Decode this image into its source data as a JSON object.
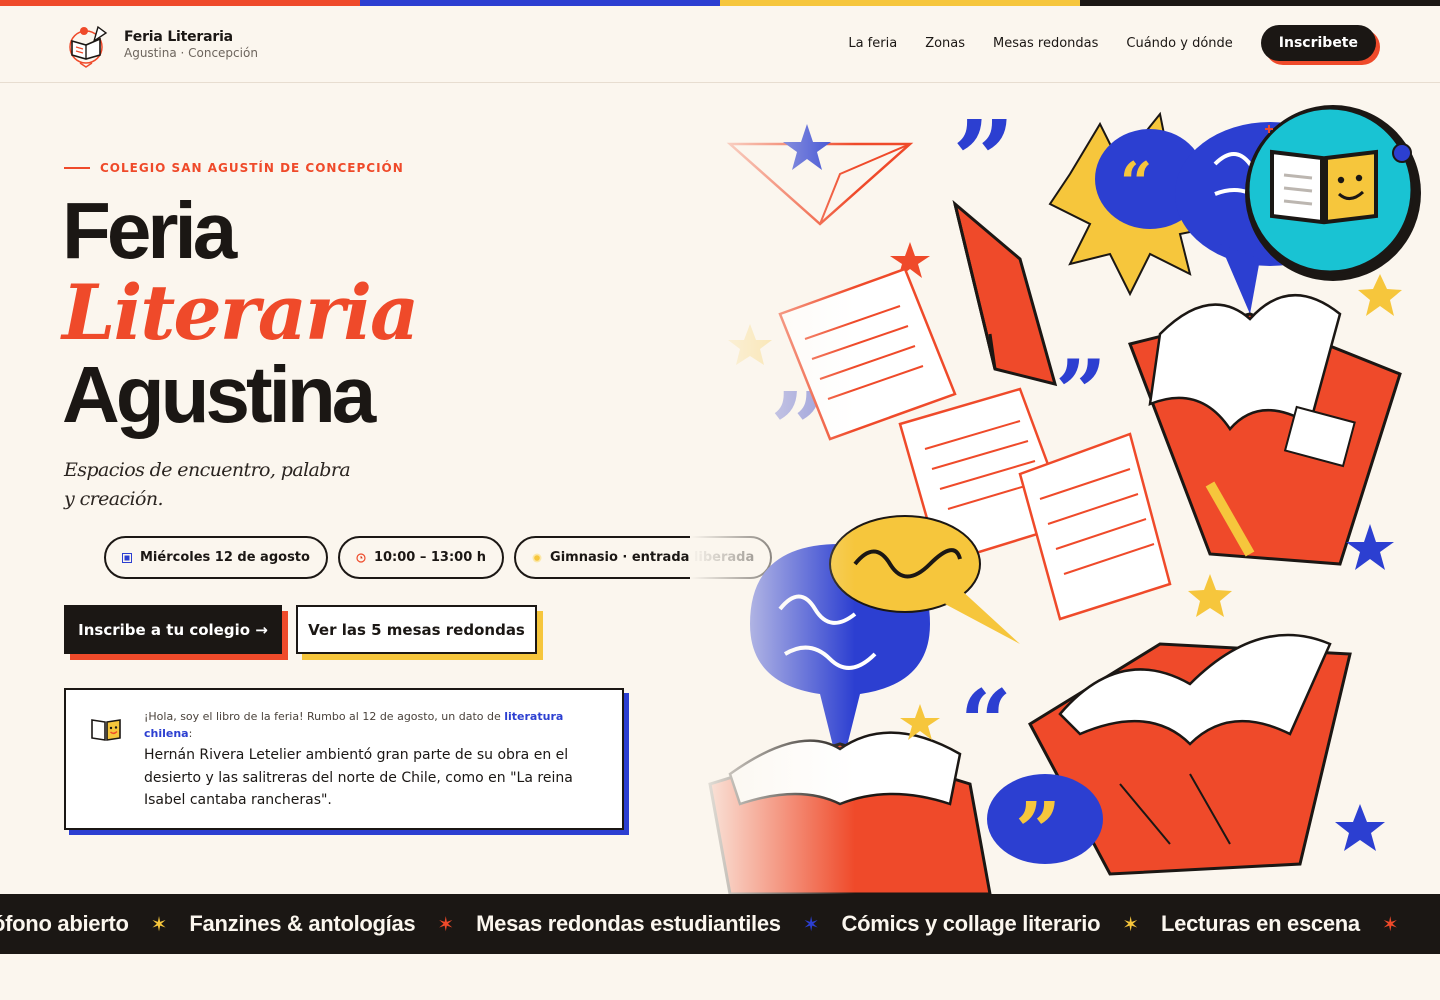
{
  "colors": {
    "strip": [
      "#ef4a2a",
      "#2c3fd1",
      "#f6c63c",
      "#1b1714"
    ],
    "accent_red": "#ef4a2a",
    "accent_blue": "#2c3fd1",
    "accent_yellow": "#f6c63c",
    "ink": "#1b1714",
    "background": "#fbf6ee"
  },
  "brand": {
    "title": "Feria Literaria",
    "subtitle": "Agustina · Concepción",
    "logo_icon": "book-logo-icon"
  },
  "nav": {
    "items": [
      "La feria",
      "Zonas",
      "Mesas redondas",
      "Cuándo y dónde"
    ],
    "cta": "Inscribete"
  },
  "hero": {
    "eyebrow": "COLEGIO SAN AGUSTÍN DE CONCEPCIÓN",
    "title_line1": "Feria",
    "title_line2": "Literaria",
    "title_line3": "Agustina",
    "subtitle": "Espacios de encuentro, palabra y creación."
  },
  "chips": [
    {
      "icon": "calendar-icon",
      "label": "Miércoles 12 de agosto"
    },
    {
      "icon": "clock-icon",
      "label": "10:00 – 13:00 h"
    },
    {
      "icon": "location-dot-icon",
      "label": "Gimnasio · entrada liberada"
    }
  ],
  "buttons": {
    "primary": "Inscribe a tu colegio →",
    "secondary": "Ver las 5 mesas redondas"
  },
  "mascot_card": {
    "icon": "book-mascot-icon",
    "intro_before": "¡Hola, soy el libro de la feria! Rumbo al 12 de agosto, un dato de ",
    "intro_highlight": "literatura chilena",
    "intro_after": ":",
    "fact": "Hernán Rivera Letelier ambientó gran parte de su obra en el desierto y las salitreras del norte de Chile, como en \"La reina Isabel cantaba rancheras\"."
  },
  "ticker": {
    "items": [
      {
        "label": "ófono abierto",
        "star_color": "#f6c63c"
      },
      {
        "label": "Fanzines & antologías",
        "star_color": "#ef4a2a"
      },
      {
        "label": "Mesas redondas estudiantiles",
        "star_color": "#2c3fd1"
      },
      {
        "label": "Cómics y collage literario",
        "star_color": "#f6c63c"
      },
      {
        "label": "Lecturas en escena",
        "star_color": "#ef4a2a"
      }
    ]
  }
}
